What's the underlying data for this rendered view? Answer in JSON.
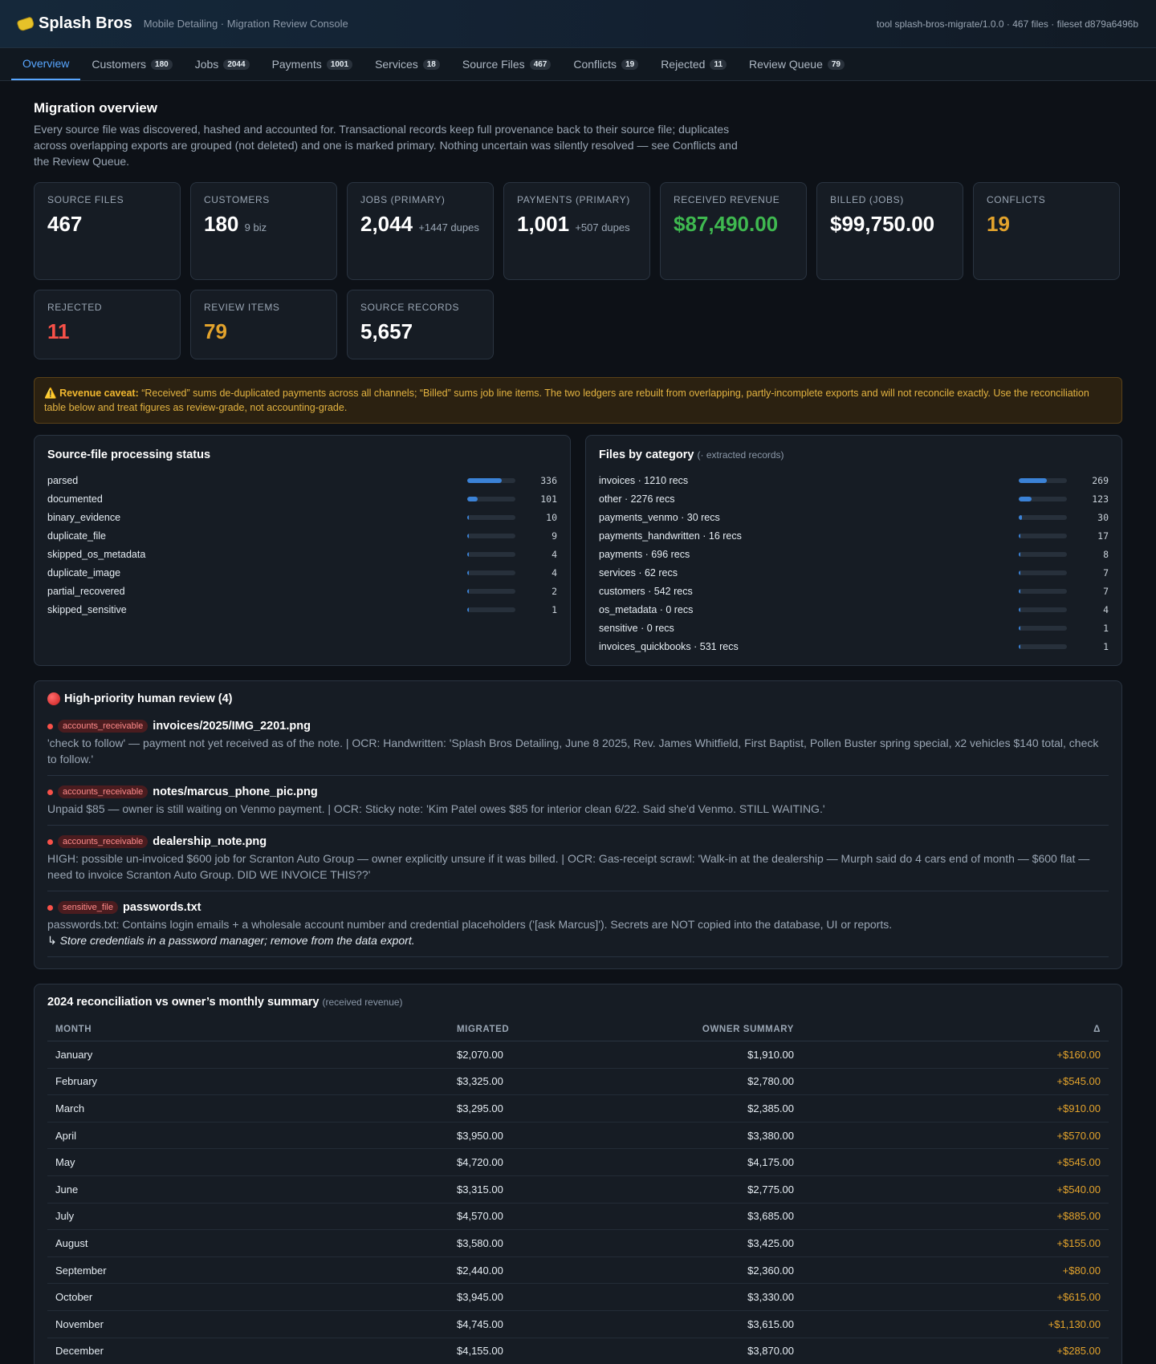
{
  "app": {
    "brand": "Splash Bros",
    "subtitle": "Mobile Detailing · Migration Review Console",
    "tool_info": "tool splash-bros-migrate/1.0.0 · 467 files · fileset d879a6496b"
  },
  "tabs": [
    {
      "label": "Overview",
      "count": ""
    },
    {
      "label": "Customers",
      "count": "180"
    },
    {
      "label": "Jobs",
      "count": "2044"
    },
    {
      "label": "Payments",
      "count": "1001"
    },
    {
      "label": "Services",
      "count": "18"
    },
    {
      "label": "Source Files",
      "count": "467"
    },
    {
      "label": "Conflicts",
      "count": "19"
    },
    {
      "label": "Rejected",
      "count": "11"
    },
    {
      "label": "Review Queue",
      "count": "79"
    }
  ],
  "overview": {
    "title": "Migration overview",
    "intro": "Every source file was discovered, hashed and accounted for. Transactional records keep full provenance back to their source file; duplicates across overlapping exports are grouped (not deleted) and one is marked primary. Nothing uncertain was silently resolved — see Conflicts and the Review Queue."
  },
  "stats": [
    {
      "label": "SOURCE FILES",
      "value": "467",
      "note": ""
    },
    {
      "label": "CUSTOMERS",
      "value": "180",
      "note": "9 biz"
    },
    {
      "label": "JOBS (PRIMARY)",
      "value": "2,044",
      "note": "+1447 dupes"
    },
    {
      "label": "PAYMENTS (PRIMARY)",
      "value": "1,001",
      "note": "+507 dupes"
    },
    {
      "label": "RECEIVED REVENUE",
      "value": "$87,490.00",
      "note": ""
    },
    {
      "label": "BILLED (JOBS)",
      "value": "$99,750.00",
      "note": ""
    },
    {
      "label": "CONFLICTS",
      "value": "19",
      "note": ""
    },
    {
      "label": "REJECTED",
      "value": "11",
      "note": ""
    },
    {
      "label": "REVIEW ITEMS",
      "value": "79",
      "note": ""
    },
    {
      "label": "SOURCE RECORDS",
      "value": "5,657",
      "note": ""
    }
  ],
  "colors": {
    "green": "#3fb950",
    "amber": "#e3a32c",
    "red": "#f85149",
    "accent": "#58a6ff"
  },
  "caveat": {
    "icon": "⚠️",
    "lead": "Revenue caveat:",
    "text": " “Received” sums de-duplicated payments across all channels; “Billed” sums job line items. The two ledgers are rebuilt from overlapping, partly-incomplete exports and will not reconcile exactly. Use the reconciliation table below and treat figures as review-grade, not accounting-grade."
  },
  "processing": {
    "title": "Source-file processing status",
    "rows": [
      {
        "label": "parsed",
        "count": 336,
        "fill": 0.72
      },
      {
        "label": "documented",
        "count": 101,
        "fill": 0.22
      },
      {
        "label": "binary_evidence",
        "count": 10,
        "fill": 0.025
      },
      {
        "label": "duplicate_file",
        "count": 9,
        "fill": 0.022
      },
      {
        "label": "skipped_os_metadata",
        "count": 4,
        "fill": 0.012
      },
      {
        "label": "duplicate_image",
        "count": 4,
        "fill": 0.012
      },
      {
        "label": "partial_recovered",
        "count": 2,
        "fill": 0.006
      },
      {
        "label": "skipped_sensitive",
        "count": 1,
        "fill": 0.003
      }
    ]
  },
  "categories": {
    "title": "Files by category",
    "subtitle": "(· extracted records)",
    "rows": [
      {
        "label": "invoices · 1210 recs",
        "count": 269,
        "fill": 0.58
      },
      {
        "label": "other · 2276 recs",
        "count": 123,
        "fill": 0.27
      },
      {
        "label": "payments_venmo · 30 recs",
        "count": 30,
        "fill": 0.065
      },
      {
        "label": "payments_handwritten · 16 recs",
        "count": 17,
        "fill": 0.037
      },
      {
        "label": "payments · 696 recs",
        "count": 8,
        "fill": 0.018
      },
      {
        "label": "services · 62 recs",
        "count": 7,
        "fill": 0.016
      },
      {
        "label": "customers · 542 recs",
        "count": 7,
        "fill": 0.016
      },
      {
        "label": "os_metadata · 0 recs",
        "count": 4,
        "fill": 0.01
      },
      {
        "label": "sensitive · 0 recs",
        "count": 1,
        "fill": 0.003
      },
      {
        "label": "invoices_quickbooks · 531 recs",
        "count": 1,
        "fill": 0.003
      }
    ]
  },
  "review": {
    "title": "High-priority human review (4)",
    "items": [
      {
        "tag": "accounts_receivable",
        "file": "invoices/2025/IMG_2201.png",
        "text": "'check to follow' — payment not yet received as of the note. | OCR: Handwritten: 'Splash Bros Detailing, June 8 2025, Rev. James Whitfield, First Baptist, Pollen Buster spring special, x2 vehicles $140 total, check to follow.'",
        "rec": ""
      },
      {
        "tag": "accounts_receivable",
        "file": "notes/marcus_phone_pic.png",
        "text": "Unpaid $85 — owner is still waiting on Venmo payment. | OCR: Sticky note: 'Kim Patel owes $85 for interior clean 6/22. Said she'd Venmo. STILL WAITING.'",
        "rec": ""
      },
      {
        "tag": "accounts_receivable",
        "file": "dealership_note.png",
        "text": "HIGH: possible un-invoiced $600 job for Scranton Auto Group — owner explicitly unsure if it was billed. | OCR: Gas-receipt scrawl: 'Walk-in at the dealership — Murph said do 4 cars end of month — $600 flat — need to invoice Scranton Auto Group. DID WE INVOICE THIS??'",
        "rec": ""
      },
      {
        "tag": "sensitive_file",
        "file": "passwords.txt",
        "text": "passwords.txt: Contains login emails + a wholesale account number and credential placeholders ('[ask Marcus]'). Secrets are NOT copied into the database, UI or reports.",
        "rec": "↳ Store credentials in a password manager; remove from the data export."
      }
    ]
  },
  "reconciliation": {
    "title": "2024 reconciliation vs owner’s monthly summary",
    "subtitle": "(received revenue)",
    "headers": [
      "MONTH",
      "MIGRATED",
      "OWNER SUMMARY",
      "Δ"
    ],
    "rows": [
      [
        "January",
        "$2,070.00",
        "$1,910.00",
        "+$160.00"
      ],
      [
        "February",
        "$3,325.00",
        "$2,780.00",
        "+$545.00"
      ],
      [
        "March",
        "$3,295.00",
        "$2,385.00",
        "+$910.00"
      ],
      [
        "April",
        "$3,950.00",
        "$3,380.00",
        "+$570.00"
      ],
      [
        "May",
        "$4,720.00",
        "$4,175.00",
        "+$545.00"
      ],
      [
        "June",
        "$3,315.00",
        "$2,775.00",
        "+$540.00"
      ],
      [
        "July",
        "$4,570.00",
        "$3,685.00",
        "+$885.00"
      ],
      [
        "August",
        "$3,580.00",
        "$3,425.00",
        "+$155.00"
      ],
      [
        "September",
        "$2,440.00",
        "$2,360.00",
        "+$80.00"
      ],
      [
        "October",
        "$3,945.00",
        "$3,330.00",
        "+$615.00"
      ],
      [
        "November",
        "$4,745.00",
        "$3,615.00",
        "+$1,130.00"
      ],
      [
        "December",
        "$4,155.00",
        "$3,870.00",
        "+$285.00"
      ]
    ]
  }
}
